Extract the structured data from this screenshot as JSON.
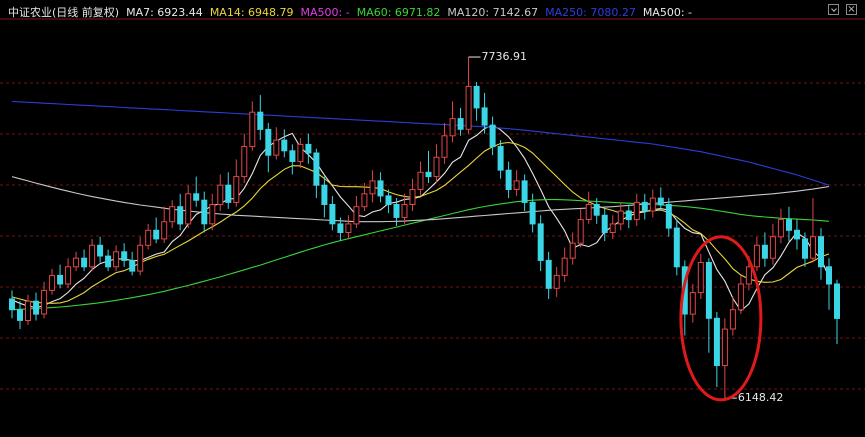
{
  "chart_title": "中证农业(日线 前复权)",
  "legend": [
    {
      "label": "MA7: 6923.44",
      "color": "#e8e8e8"
    },
    {
      "label": "MA14: 6948.79",
      "color": "#e9d63a"
    },
    {
      "label": "MA500: -",
      "color": "#e23be4"
    },
    {
      "label": "MA60: 6971.82",
      "color": "#39d439"
    },
    {
      "label": "MA120: 7142.67",
      "color": "#c8c8c8"
    },
    {
      "label": "MA250: 7080.27",
      "color": "#2b3fd8"
    },
    {
      "label": "MA500: -",
      "color": "#e8e8e8"
    }
  ],
  "controls": {
    "minimize": "",
    "close": "×"
  },
  "colors": {
    "up": "#e04646",
    "down": "#3ad6e6",
    "grid": "#7a1010",
    "background": "#000000",
    "circle": "#e01a1a"
  },
  "chart_data": {
    "type": "candlestick",
    "ylim": [
      6000,
      7900
    ],
    "grid": true,
    "candles": [
      [
        6610,
        6560,
        6650,
        6520
      ],
      [
        6560,
        6510,
        6600,
        6470
      ],
      [
        6510,
        6600,
        6630,
        6490
      ],
      [
        6600,
        6540,
        6640,
        6510
      ],
      [
        6540,
        6650,
        6690,
        6520
      ],
      [
        6650,
        6720,
        6750,
        6630
      ],
      [
        6720,
        6680,
        6770,
        6660
      ],
      [
        6680,
        6760,
        6800,
        6660
      ],
      [
        6760,
        6800,
        6830,
        6740
      ],
      [
        6800,
        6760,
        6840,
        6740
      ],
      [
        6760,
        6860,
        6890,
        6740
      ],
      [
        6860,
        6810,
        6900,
        6780
      ],
      [
        6810,
        6760,
        6840,
        6740
      ],
      [
        6760,
        6830,
        6860,
        6740
      ],
      [
        6830,
        6790,
        6870,
        6760
      ],
      [
        6790,
        6740,
        6830,
        6720
      ],
      [
        6740,
        6860,
        6900,
        6720
      ],
      [
        6860,
        6930,
        6960,
        6840
      ],
      [
        6930,
        6890,
        6990,
        6870
      ],
      [
        6890,
        6970,
        7040,
        6870
      ],
      [
        6970,
        7040,
        7070,
        6940
      ],
      [
        7040,
        6960,
        7100,
        6930
      ],
      [
        6960,
        7100,
        7140,
        6940
      ],
      [
        7100,
        7070,
        7180,
        7040
      ],
      [
        7070,
        6960,
        7110,
        6920
      ],
      [
        6960,
        7050,
        7100,
        6930
      ],
      [
        7050,
        7140,
        7190,
        7020
      ],
      [
        7140,
        7060,
        7200,
        7030
      ],
      [
        7060,
        7180,
        7260,
        7040
      ],
      [
        7180,
        7320,
        7380,
        7150
      ],
      [
        7320,
        7480,
        7530,
        7300
      ],
      [
        7480,
        7400,
        7560,
        7350
      ],
      [
        7400,
        7280,
        7430,
        7200
      ],
      [
        7280,
        7350,
        7410,
        7260
      ],
      [
        7350,
        7300,
        7400,
        7270
      ],
      [
        7300,
        7250,
        7330,
        7190
      ],
      [
        7250,
        7330,
        7360,
        7220
      ],
      [
        7330,
        7290,
        7380,
        7240
      ],
      [
        7290,
        7140,
        7310,
        7080
      ],
      [
        7140,
        7050,
        7180,
        6990
      ],
      [
        7050,
        6960,
        7090,
        6930
      ],
      [
        6960,
        6920,
        6990,
        6880
      ],
      [
        6920,
        6960,
        7000,
        6890
      ],
      [
        6960,
        7040,
        7090,
        6940
      ],
      [
        7040,
        7100,
        7150,
        7020
      ],
      [
        7100,
        7160,
        7210,
        7060
      ],
      [
        7160,
        7090,
        7200,
        7060
      ],
      [
        7090,
        7050,
        7120,
        7010
      ],
      [
        7050,
        6990,
        7080,
        6950
      ],
      [
        6990,
        7050,
        7100,
        6960
      ],
      [
        7050,
        7120,
        7170,
        7020
      ],
      [
        7120,
        7200,
        7250,
        7090
      ],
      [
        7200,
        7180,
        7300,
        7150
      ],
      [
        7180,
        7270,
        7330,
        7150
      ],
      [
        7270,
        7370,
        7430,
        7240
      ],
      [
        7370,
        7450,
        7530,
        7340
      ],
      [
        7450,
        7400,
        7500,
        7370
      ],
      [
        7400,
        7600,
        7737,
        7380
      ],
      [
        7600,
        7500,
        7620,
        7440
      ],
      [
        7500,
        7420,
        7570,
        7380
      ],
      [
        7420,
        7320,
        7460,
        7280
      ],
      [
        7320,
        7210,
        7350,
        7170
      ],
      [
        7210,
        7120,
        7250,
        7080
      ],
      [
        7120,
        7160,
        7210,
        7090
      ],
      [
        7160,
        7060,
        7190,
        7020
      ],
      [
        7060,
        6960,
        7100,
        6920
      ],
      [
        6960,
        6790,
        7000,
        6740
      ],
      [
        6790,
        6660,
        6830,
        6610
      ],
      [
        6660,
        6720,
        6760,
        6620
      ],
      [
        6720,
        6800,
        6850,
        6690
      ],
      [
        6800,
        6870,
        6920,
        6770
      ],
      [
        6870,
        6980,
        7030,
        6850
      ],
      [
        6980,
        7050,
        7110,
        6960
      ],
      [
        7050,
        7000,
        7080,
        6960
      ],
      [
        7000,
        6920,
        7030,
        6880
      ],
      [
        6920,
        6960,
        7000,
        6890
      ],
      [
        6960,
        7020,
        7060,
        6930
      ],
      [
        7020,
        6980,
        7050,
        6940
      ],
      [
        6980,
        7060,
        7100,
        6950
      ],
      [
        7060,
        7020,
        7100,
        6980
      ],
      [
        7020,
        7080,
        7120,
        6990
      ],
      [
        7080,
        7050,
        7130,
        7020
      ],
      [
        7050,
        6940,
        7080,
        6900
      ],
      [
        6940,
        6760,
        6980,
        6720
      ],
      [
        6760,
        6540,
        6790,
        6440
      ],
      [
        6540,
        6640,
        6680,
        6500
      ],
      [
        6640,
        6780,
        6820,
        6610
      ],
      [
        6780,
        6520,
        6800,
        6360
      ],
      [
        6520,
        6300,
        6550,
        6200
      ],
      [
        6300,
        6470,
        6520,
        6150
      ],
      [
        6470,
        6560,
        6620,
        6440
      ],
      [
        6560,
        6680,
        6720,
        6540
      ],
      [
        6680,
        6760,
        6810,
        6650
      ],
      [
        6760,
        6860,
        6900,
        6740
      ],
      [
        6860,
        6800,
        6920,
        6760
      ],
      [
        6800,
        6900,
        6960,
        6770
      ],
      [
        6900,
        6980,
        7030,
        6870
      ],
      [
        6980,
        6930,
        7040,
        6880
      ],
      [
        6930,
        6890,
        6980,
        6840
      ],
      [
        6890,
        6800,
        6920,
        6760
      ],
      [
        6800,
        6900,
        7080,
        6780
      ],
      [
        6900,
        6760,
        6940,
        6700
      ],
      [
        6760,
        6680,
        6800,
        6560
      ],
      [
        6680,
        6520,
        6700,
        6400
      ]
    ],
    "series": [
      {
        "name": "MA7",
        "values": [
          6606,
          6590,
          6577,
          6570,
          6580,
          6598,
          6612,
          6641,
          6680,
          6707,
          6747,
          6775,
          6787,
          6797,
          6797,
          6789,
          6789,
          6804,
          6819,
          6829,
          6877,
          6906,
          6959,
          7004,
          7023,
          7045,
          7053,
          7076,
          7078,
          7126,
          7194,
          7279,
          7320,
          7345,
          7366,
          7381,
          7316,
          7282,
          7244,
          7187,
          7137,
          7085,
          7044,
          7000,
          6994,
          7015,
          7025,
          7055,
          7061,
          7074,
          7077,
          7086,
          7120,
          7156,
          7195,
          7247,
          7271,
          7349,
          7372,
          7404,
          7419,
          7398,
          7365,
          7319,
          7265,
          7195,
          7120,
          7041,
          6986,
          6927,
          6846,
          6864,
          6854,
          6872,
          6923,
          6949,
          6975,
          6996,
          7010,
          7016,
          7026,
          7031,
          7024,
          6976,
          6939,
          6919,
          6913,
          6830,
          6747,
          6693,
          6613,
          6555,
          6587,
          6659,
          6723,
          6756,
          6810,
          6873,
          6918,
          6894,
          6834,
          6799,
          6710
        ],
        "color": "#e8e8e8"
      },
      {
        "name": "MA14",
        "values": [
          6620,
          6610,
          6600,
          6594,
          6592,
          6590,
          6592,
          6601,
          6620,
          6640,
          6668,
          6690,
          6712,
          6733,
          6742,
          6758,
          6779,
          6795,
          6808,
          6818,
          6839,
          6860,
          6880,
          6903,
          6926,
          6946,
          6968,
          6993,
          7015,
          7044,
          7080,
          7124,
          7159,
          7186,
          7214,
          7231,
          7230,
          7215,
          7199,
          7171,
          7141,
          7134,
          7133,
          7133,
          7131,
          7129,
          7125,
          7109,
          7096,
          7088,
          7083,
          7088,
          7102,
          7116,
          7139,
          7170,
          7201,
          7232,
          7266,
          7299,
          7319,
          7334,
          7339,
          7332,
          7316,
          7290,
          7253,
          7216,
          7180,
          7143,
          7108,
          7081,
          7063,
          7045,
          7032,
          7022,
          7010,
          7010,
          7015,
          7019,
          7021,
          7025,
          7012,
          6991,
          6963,
          6932,
          6915,
          6880,
          6837,
          6797,
          6751,
          6722,
          6703,
          6693,
          6688,
          6689,
          6701,
          6729,
          6757,
          6772,
          6786,
          6807,
          6820
        ],
        "color": "#e9d63a"
      },
      {
        "name": "MA60",
        "values": [
          6560,
          6562,
          6564,
          6566,
          6568,
          6570,
          6573,
          6576,
          6580,
          6584,
          6588,
          6593,
          6598,
          6604,
          6610,
          6616,
          6623,
          6630,
          6638,
          6646,
          6655,
          6664,
          6673,
          6683,
          6693,
          6703,
          6713,
          6724,
          6735,
          6746,
          6757,
          6768,
          6780,
          6792,
          6804,
          6816,
          6828,
          6840,
          6851,
          6862,
          6872,
          6882,
          6891,
          6900,
          6909,
          6918,
          6927,
          6936,
          6945,
          6954,
          6963,
          6972,
          6981,
          6990,
          6999,
          7008,
          7017,
          7026,
          7034,
          7041,
          7047,
          7053,
          7058,
          7063,
          7067,
          7070,
          7072,
          7073,
          7073,
          7072,
          7070,
          7068,
          7066,
          7064,
          7062,
          7060,
          7058,
          7056,
          7054,
          7052,
          7050,
          7048,
          7046,
          7044,
          7041,
          7037,
          7033,
          7028,
          7022,
          7016,
          7010,
          7004,
          6999,
          6995,
          6992,
          6989,
          6986,
          6984,
          6982,
          6980,
          6978,
          6975,
          6972
        ],
        "color": "#39d439"
      },
      {
        "name": "MA120",
        "values": [
          7180,
          7170,
          7160,
          7150,
          7140,
          7130,
          7121,
          7112,
          7103,
          7095,
          7087,
          7080,
          7073,
          7066,
          7060,
          7054,
          7048,
          7043,
          7038,
          7033,
          7028,
          7024,
          7020,
          7016,
          7012,
          7009,
          7006,
          7003,
          7000,
          6998,
          6996,
          6994,
          6992,
          6990,
          6988,
          6986,
          6984,
          6982,
          6980,
          6978,
          6976,
          6974,
          6972,
          6970,
          6970,
          6970,
          6970,
          6971,
          6972,
          6973,
          6975,
          6977,
          6979,
          6981,
          6984,
          6987,
          6990,
          6993,
          6996,
          6999,
          7002,
          7005,
          7008,
          7011,
          7014,
          7017,
          7020,
          7023,
          7026,
          7028,
          7030,
          7032,
          7034,
          7036,
          7038,
          7040,
          7043,
          7046,
          7049,
          7052,
          7055,
          7058,
          7061,
          7064,
          7067,
          7070,
          7073,
          7076,
          7079,
          7082,
          7085,
          7088,
          7091,
          7094,
          7097,
          7100,
          7104,
          7108,
          7112,
          7117,
          7122,
          7128,
          7134
        ],
        "color": "#c8c8c8"
      },
      {
        "name": "MA250",
        "values": [
          7530,
          7528,
          7526,
          7524,
          7522,
          7520,
          7518,
          7516,
          7514,
          7512,
          7510,
          7508,
          7506,
          7504,
          7502,
          7500,
          7498,
          7496,
          7494,
          7492,
          7490,
          7488,
          7486,
          7484,
          7482,
          7480,
          7478,
          7476,
          7474,
          7472,
          7470,
          7468,
          7466,
          7464,
          7462,
          7460,
          7458,
          7456,
          7454,
          7452,
          7450,
          7448,
          7446,
          7444,
          7442,
          7440,
          7438,
          7436,
          7434,
          7432,
          7430,
          7428,
          7426,
          7424,
          7422,
          7420,
          7418,
          7416,
          7414,
          7412,
          7409,
          7406,
          7403,
          7400,
          7396,
          7392,
          7388,
          7384,
          7380,
          7376,
          7372,
          7368,
          7364,
          7360,
          7356,
          7352,
          7348,
          7344,
          7340,
          7336,
          7332,
          7326,
          7320,
          7314,
          7308,
          7302,
          7296,
          7288,
          7280,
          7272,
          7264,
          7256,
          7248,
          7238,
          7228,
          7218,
          7208,
          7198,
          7188,
          7176,
          7164,
          7152,
          7140
        ],
        "color": "#2b3fd8"
      }
    ],
    "annotations": [
      {
        "label": "7736.91",
        "value": 7736.91,
        "index": 57
      },
      {
        "label": "6148.42",
        "value": 6148.42,
        "index": 89
      }
    ],
    "highlight": {
      "from_index": 84,
      "to_index": 93,
      "low": 6140,
      "high": 6900
    }
  }
}
